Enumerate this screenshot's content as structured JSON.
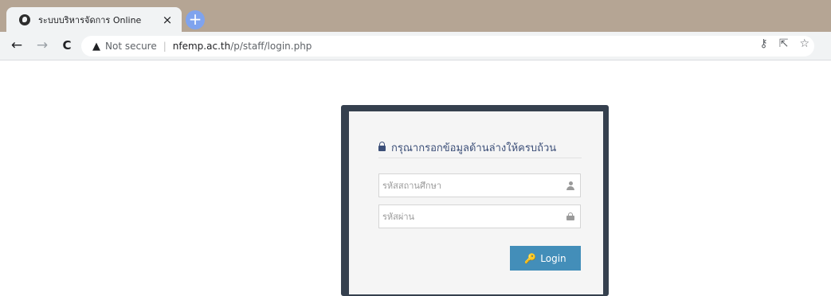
{
  "browser": {
    "tab": {
      "title": "ระบบบริหารจัดการ Online",
      "close_glyph": "×",
      "favicon": "globe-icon"
    },
    "new_tab_glyph": "+",
    "nav": {
      "back": "←",
      "forward": "→",
      "reload": "C"
    },
    "omnibox": {
      "warning_glyph": "▲",
      "security_label": "Not secure",
      "separator": "|",
      "url_host": "nfemp.ac.th",
      "url_path": "/p/staff/login.php",
      "key_glyph": "⚷",
      "share_glyph": "⇱",
      "star_glyph": "☆"
    },
    "colors": {
      "tabstrip": "#b5a594",
      "toolbar": "#f1f3f4",
      "new_tab": "#7fa3ee"
    }
  },
  "login": {
    "heading": "กรุณากรอกข้อมูลด้านล่างให้ครบถ้วน",
    "school_code_placeholder": "รหัสสถานศึกษา",
    "school_code_value": "",
    "password_placeholder": "รหัสผ่าน",
    "password_value": "",
    "button_icon": "key-icon",
    "button_key_glyph": "🔑",
    "button_label": "Login",
    "colors": {
      "frame": "#35404e",
      "panel": "#f5f5f5",
      "heading": "#3c4f78",
      "button": "#438eb9"
    }
  }
}
